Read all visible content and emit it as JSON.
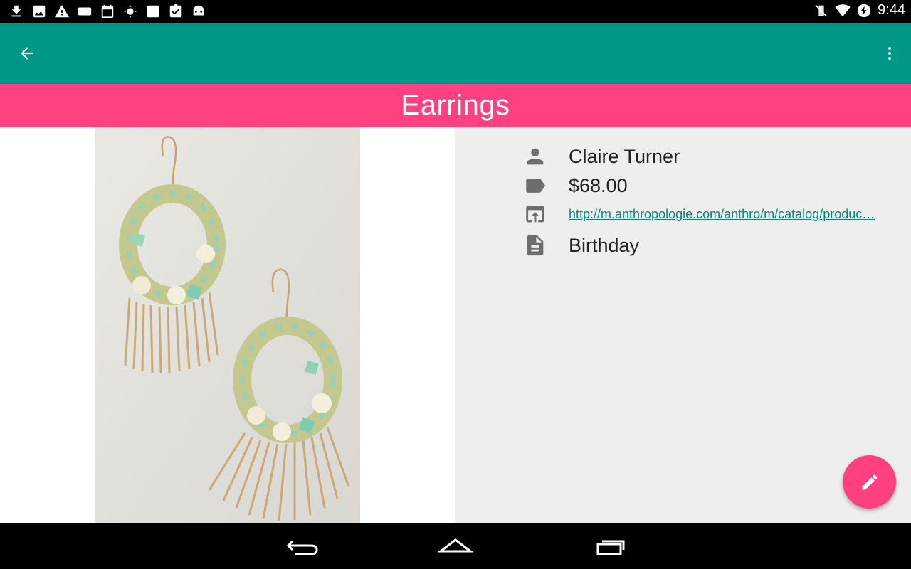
{
  "status_bar": {
    "time": "9:44",
    "left_icons": [
      "download-icon",
      "image-icon",
      "warning-icon",
      "badge-999-icon",
      "calendar-icon",
      "settings-icon",
      "translate-icon",
      "clipboard-check-icon",
      "android-icon"
    ],
    "right_icons": [
      "vibrate-off-icon",
      "wifi-icon",
      "battery-charging-icon"
    ]
  },
  "app_bar": {
    "color": "#009688",
    "back_icon": "arrow-back-icon",
    "overflow_icon": "more-vert-icon"
  },
  "title": {
    "text": "Earrings",
    "color": "#ff4081"
  },
  "details": {
    "person": "Claire Turner",
    "price": "$68.00",
    "url": "http://m.anthropologie.com/anthro/m/catalog/produc…",
    "note": "Birthday"
  },
  "fab": {
    "icon": "edit-pencil-icon",
    "color": "#ff4081"
  },
  "nav_bar": {
    "buttons": [
      "back-nav-icon",
      "home-nav-icon",
      "recents-nav-icon"
    ]
  }
}
